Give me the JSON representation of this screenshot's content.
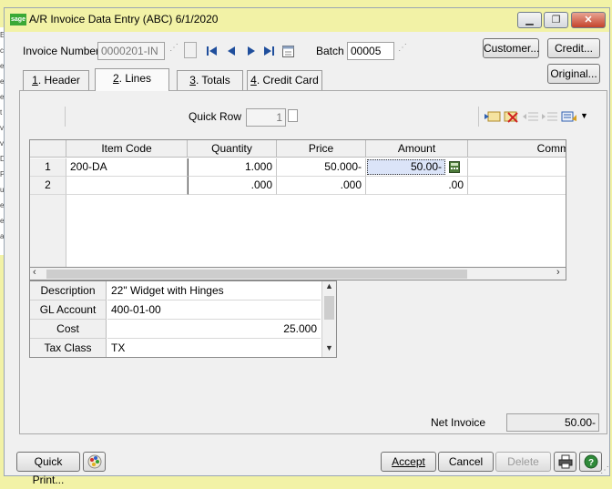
{
  "window": {
    "title": "A/R Invoice Data Entry (ABC) 6/1/2020",
    "logo_text": "sage",
    "minimize": "▁",
    "restore": "❐",
    "close": "✕"
  },
  "bg_strip_letters": [
    "E",
    "c",
    "e",
    "e",
    "e",
    "t",
    "v",
    "v",
    "D",
    "P",
    "u",
    "e",
    "e",
    "a"
  ],
  "header": {
    "invoice_label": "Invoice Number",
    "invoice_value": "0000201-IN",
    "batch_label": "Batch",
    "batch_value": "00005",
    "customer_button": "Customer...",
    "credit_button": "Credit...",
    "original_button": "Original..."
  },
  "tabs": [
    {
      "num": "1",
      "label": "Header"
    },
    {
      "num": "2",
      "label": "Lines"
    },
    {
      "num": "3",
      "label": "Totals"
    },
    {
      "num": "4",
      "label": "Credit Card"
    }
  ],
  "quick_row": {
    "label": "Quick Row",
    "value": "1"
  },
  "grid": {
    "columns": [
      "Item Code",
      "Quantity",
      "Price",
      "Amount",
      "Comm"
    ],
    "rows": [
      {
        "num": "1",
        "item_code": "200-DA",
        "quantity": "1.000",
        "price": "50.000-",
        "amount": "50.00-"
      },
      {
        "num": "2",
        "item_code": "",
        "quantity": ".000",
        "price": ".000",
        "amount": ".00"
      }
    ]
  },
  "detail": {
    "rows": [
      {
        "label": "Description",
        "value": "22\" Widget with Hinges",
        "align": "left"
      },
      {
        "label": "GL Account",
        "value": "400-01-00",
        "align": "left"
      },
      {
        "label": "Cost",
        "value": "25.000",
        "align": "right"
      },
      {
        "label": "Tax Class",
        "value": "TX",
        "align": "left"
      }
    ]
  },
  "net_invoice": {
    "label": "Net Invoice",
    "value": "50.00-"
  },
  "footer": {
    "quick_print": "Quick Print...",
    "accept": "Accept",
    "cancel": "Cancel",
    "delete": "Delete"
  }
}
